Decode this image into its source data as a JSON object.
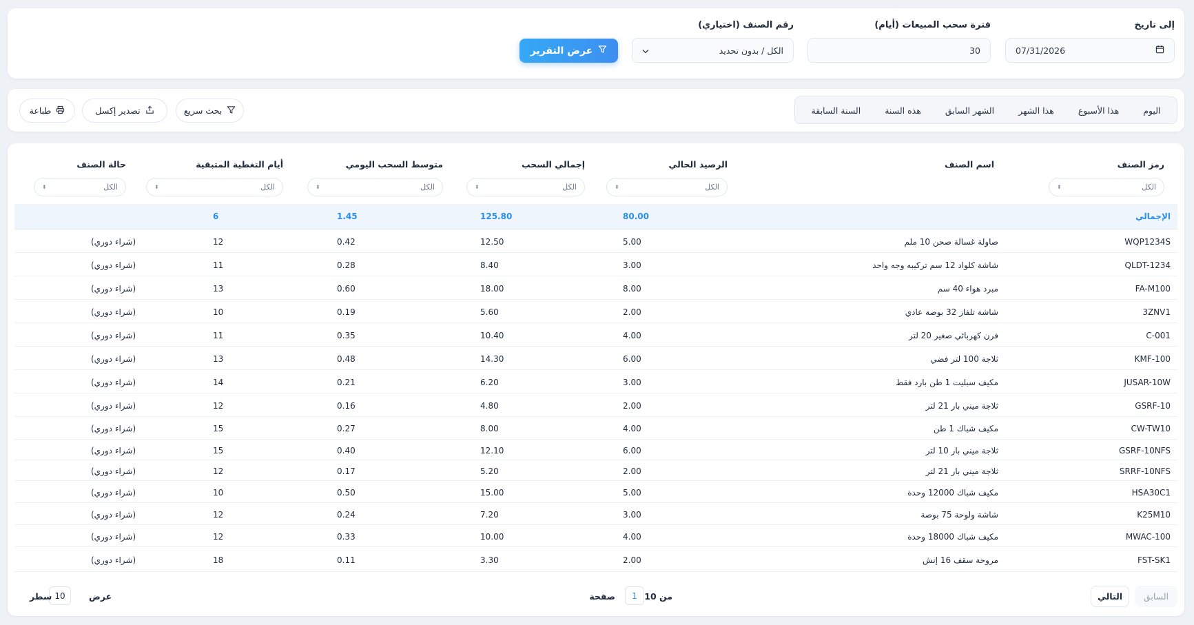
{
  "filters": {
    "to_date_label": "إلى تاريخ",
    "to_date_value": "07/31/2026",
    "period_label": "فترة سحب المبيعات (أيام)",
    "period_value": "30",
    "item_label": "رقم الصنف (اختياري)",
    "item_value": "الكل / بدون تحديد",
    "show_report_button": "عرض التقرير"
  },
  "quick_ranges": [
    "اليوم",
    "هذا الأسبوع",
    "هذا الشهر",
    "الشهر السابق",
    "هذه السنة",
    "السنة السابقة"
  ],
  "toolbar": {
    "quick_search": "بحث سريع",
    "export_excel": "تصدير إكسل",
    "print": "طباعة"
  },
  "table": {
    "columns": {
      "code": "رمز الصنف",
      "name": "اسم الصنف",
      "balance": "الرصيد الحالي",
      "total_draw": "إجمالي السحب",
      "avg_draw": "متوسط السحب اليومي",
      "days_left": "أيام التغطية المتبقية",
      "status": "حالة الصنف"
    },
    "filter_placeholder": "الكل",
    "total_row": {
      "label": "الإجمالي",
      "balance": "80.00",
      "total_draw": "125.80",
      "avg_draw": "1.45",
      "days_left": "6"
    },
    "rows": [
      {
        "code": "WQP1234S",
        "name": "صاولة غسالة صحن 10 ملم",
        "balance": "5.00",
        "total_draw": "12.50",
        "avg_draw": "0.42",
        "days_left": "12",
        "status": "(شراء دوري)"
      },
      {
        "code": "QLDT-1234",
        "name": "شاشة كلواد 12 سم تركيبه وجه واحد",
        "balance": "3.00",
        "total_draw": "8.40",
        "avg_draw": "0.28",
        "days_left": "11",
        "status": "(شراء دوري)"
      },
      {
        "code": "FA-M100",
        "name": "مبرد هواء 40 سم",
        "balance": "8.00",
        "total_draw": "18.00",
        "avg_draw": "0.60",
        "days_left": "13",
        "status": "(شراء دوري)"
      },
      {
        "code": "3ZNV1",
        "name": "شاشة تلفاز 32 بوصة عادي",
        "balance": "2.00",
        "total_draw": "5.60",
        "avg_draw": "0.19",
        "days_left": "10",
        "status": "(شراء دوري)"
      },
      {
        "code": "C-001",
        "name": "فرن كهربائي صغير 20 لتر",
        "balance": "4.00",
        "total_draw": "10.40",
        "avg_draw": "0.35",
        "days_left": "11",
        "status": "(شراء دوري)"
      },
      {
        "code": "KMF-100",
        "name": "ثلاجة 100 لتر فضي",
        "balance": "6.00",
        "total_draw": "14.30",
        "avg_draw": "0.48",
        "days_left": "13",
        "status": "(شراء دوري)"
      },
      {
        "code": "JUSAR-10W",
        "name": "مكيف سبليت 1 طن بارد فقط",
        "balance": "3.00",
        "total_draw": "6.20",
        "avg_draw": "0.21",
        "days_left": "14",
        "status": "(شراء دوري)"
      },
      {
        "code": "GSRF-10",
        "name": "ثلاجة ميني بار 21 لتر",
        "balance": "2.00",
        "total_draw": "4.80",
        "avg_draw": "0.16",
        "days_left": "12",
        "status": "(شراء دوري)"
      },
      {
        "code": "CW-TW10",
        "name": "مكيف شباك 1 طن",
        "balance": "4.00",
        "total_draw": "8.00",
        "avg_draw": "0.27",
        "days_left": "15",
        "status": "(شراء دوري)"
      },
      {
        "code": "GSRF-10NFS",
        "name": "ثلاجة ميني بار 10 لتر",
        "balance": "6.00",
        "total_draw": "12.10",
        "avg_draw": "0.40",
        "days_left": "15",
        "status": "(شراء دوري)"
      },
      {
        "code": "SRRF-10NFS",
        "name": "ثلاجة ميني بار 21 لتر",
        "balance": "2.00",
        "total_draw": "5.20",
        "avg_draw": "0.17",
        "days_left": "12",
        "status": "(شراء دوري)"
      },
      {
        "code": "HSA30C1",
        "name": "مكيف شباك 12000 وحدة",
        "balance": "5.00",
        "total_draw": "15.00",
        "avg_draw": "0.50",
        "days_left": "10",
        "status": "(شراء دوري)"
      },
      {
        "code": "K25M10",
        "name": "شاشة ولوحة 75 بوصة",
        "balance": "3.00",
        "total_draw": "7.20",
        "avg_draw": "0.24",
        "days_left": "12",
        "status": "(شراء دوري)"
      },
      {
        "code": "MWAC-100",
        "name": "مكيف شباك 18000 وحدة",
        "balance": "4.00",
        "total_draw": "10.00",
        "avg_draw": "0.33",
        "days_left": "12",
        "status": "(شراء دوري)"
      },
      {
        "code": "FST-SK1",
        "name": "مروحة سقف 16 إنش",
        "balance": "2.00",
        "total_draw": "3.30",
        "avg_draw": "0.11",
        "days_left": "18",
        "status": "(شراء دوري)"
      }
    ]
  },
  "pagination": {
    "prev": "السابق",
    "next": "التالي",
    "page_label": "صفحة",
    "current_page": "1",
    "of_label": "من 10",
    "show_label": "عرض",
    "rows_per_page": "10",
    "rows_label": "سطر"
  },
  "colors": {
    "accent": "#3d8ff0",
    "total_text": "#2b8ee8",
    "background": "#eef1f6"
  }
}
